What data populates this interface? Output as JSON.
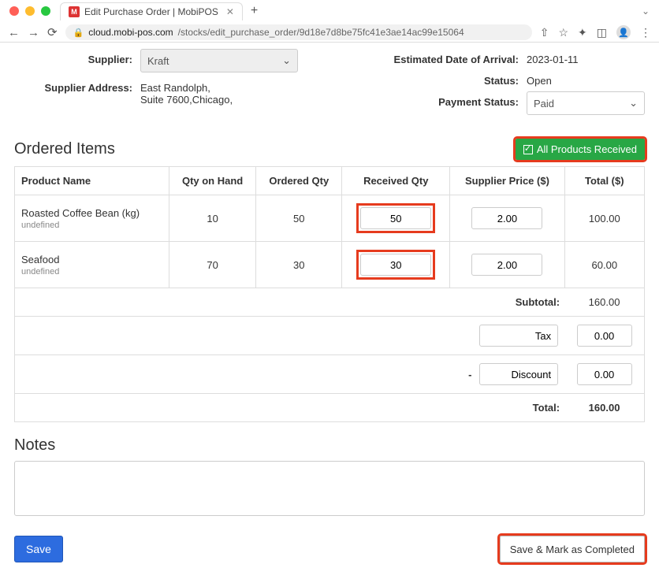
{
  "browser": {
    "tab_title": "Edit Purchase Order | MobiPOS",
    "url_domain": "cloud.mobi-pos.com",
    "url_path": "/stocks/edit_purchase_order/9d18e7d8be75fc41e3ae14ac99e15064"
  },
  "form": {
    "supplier_label": "Supplier:",
    "supplier_value": "Kraft",
    "supplier_address_label": "Supplier Address:",
    "supplier_address_line1": "East Randolph,",
    "supplier_address_line2": "Suite 7600,Chicago,",
    "eta_label": "Estimated Date of Arrival:",
    "eta_value": "2023-01-11",
    "status_label": "Status:",
    "status_value": "Open",
    "payment_status_label": "Payment Status:",
    "payment_status_value": "Paid"
  },
  "items_section": {
    "title": "Ordered Items",
    "received_button": "All Products Received",
    "headers": {
      "name": "Product Name",
      "qoh": "Qty on Hand",
      "ordered": "Ordered Qty",
      "received": "Received Qty",
      "price": "Supplier Price ($)",
      "total": "Total ($)"
    },
    "rows": [
      {
        "name": "Roasted Coffee Bean (kg)",
        "sub": "undefined",
        "qoh": "10",
        "ordered": "50",
        "received": "50",
        "price": "2.00",
        "total": "100.00"
      },
      {
        "name": "Seafood",
        "sub": "undefined",
        "qoh": "70",
        "ordered": "30",
        "received": "30",
        "price": "2.00",
        "total": "60.00"
      }
    ],
    "subtotal_label": "Subtotal:",
    "subtotal_value": "160.00",
    "tax_label": "Tax",
    "tax_value": "0.00",
    "discount_minus": "-",
    "discount_label": "Discount",
    "discount_value": "0.00",
    "total_label": "Total:",
    "total_value": "160.00"
  },
  "notes": {
    "title": "Notes",
    "value": ""
  },
  "buttons": {
    "save": "Save",
    "save_complete": "Save & Mark as Completed"
  }
}
